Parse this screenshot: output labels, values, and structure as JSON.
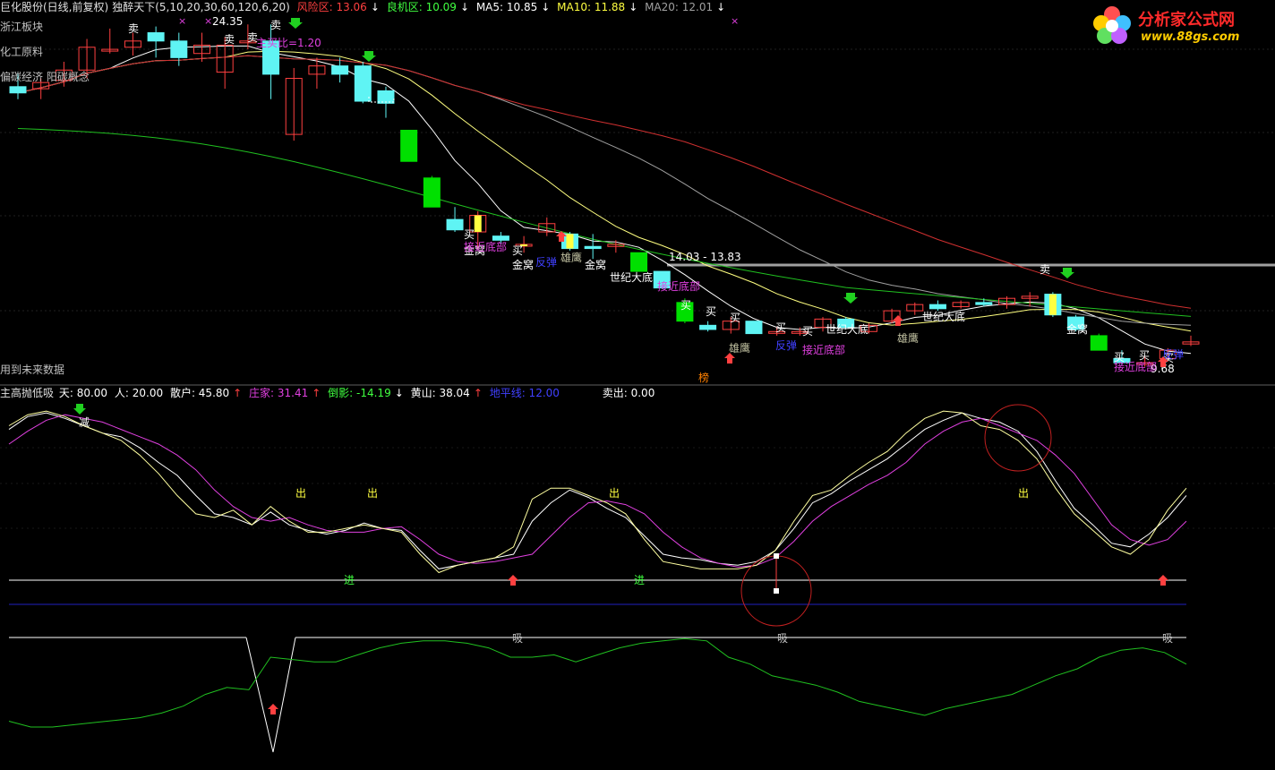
{
  "colors": {
    "bg": "#000000",
    "up": "#ff4040",
    "down_cyan": "#5ff4f4",
    "down_green": "#00e000",
    "yellow": "#ffff40",
    "magenta": "#e040e0",
    "white": "#ffffff",
    "green_line": "#20c020",
    "blue_line": "#2020c0",
    "orange": "#ff8000",
    "red_circle": "#c02020",
    "grey_line": "#a0a0a0"
  },
  "header": {
    "title": "巨化股份(日线,前复权)",
    "indicator": "独醉天下(5,10,20,30,60,120,6,20)",
    "risk_label": "风险区: 13.06",
    "good_label": "良机区: 10.09",
    "ma5": "MA5: 10.85",
    "ma10": "MA10: 11.88",
    "ma20": "MA20: 12.01"
  },
  "sidebar": {
    "sector1": "浙江板块",
    "sector2": "化工原料",
    "sector3": "偏碳经济 阳碳概念",
    "future_data": "用到未来数据"
  },
  "lower_header": {
    "name": "主高抛低吸",
    "tian": "天: 80.00",
    "ren": "人: 20.00",
    "sanhu": "散户: 45.80",
    "zhuangjia": "庄家: 31.41",
    "daoying": "倒影: -14.19",
    "huangshan": "黄山: 38.04",
    "dipingxian": "地平线: 12.00",
    "maichu": "卖出: 0.00"
  },
  "logo": {
    "name": "分析家公式网",
    "url": "www.88gs.com"
  },
  "chart_data": [
    {
      "type": "candlestick",
      "title": "巨化股份(日线,前复权)",
      "price_labels": [
        "24.35",
        "14.03 - 13.83",
        "9.68"
      ],
      "annotations_buy": [
        "买",
        "买",
        "买",
        "买",
        "买",
        "买",
        "买",
        "买",
        "买",
        "买"
      ],
      "annotations_sell": [
        "卖",
        "卖",
        "卖",
        "卖",
        "卖"
      ],
      "annotations_text": [
        {
          "text": "金窝",
          "kind": "jinwo"
        },
        {
          "text": "接近底部",
          "kind": "near"
        },
        {
          "text": "金窝",
          "kind": "jinwo"
        },
        {
          "text": "雄鹰",
          "kind": "xiongying"
        },
        {
          "text": "金窝",
          "kind": "jinwo"
        },
        {
          "text": "世纪大底",
          "kind": "shiji"
        },
        {
          "text": "接近底部",
          "kind": "near"
        },
        {
          "text": "雄鹰",
          "kind": "xiongying"
        },
        {
          "text": "反弹",
          "kind": "fantan"
        },
        {
          "text": "接近底部",
          "kind": "near"
        },
        {
          "text": "世纪大底",
          "kind": "shiji"
        },
        {
          "text": "雄鹰",
          "kind": "xiongying"
        },
        {
          "text": "世纪大底",
          "kind": "shiji"
        },
        {
          "text": "金窝",
          "kind": "jinwo"
        },
        {
          "text": "接近底部",
          "kind": "near"
        },
        {
          "text": "反弹",
          "kind": "fantan"
        },
        {
          "text": "反弹",
          "kind": "fantan"
        },
        {
          "text": "主买比=1.20",
          "kind": "ratio"
        },
        {
          "text": "榜",
          "kind": "bang"
        }
      ],
      "candles": [
        {
          "o": 17.6,
          "h": 18.3,
          "l": 17.0,
          "c": 17.3
        },
        {
          "o": 17.5,
          "h": 18.0,
          "l": 17.0,
          "c": 17.8
        },
        {
          "o": 17.9,
          "h": 18.8,
          "l": 17.6,
          "c": 18.4
        },
        {
          "o": 18.4,
          "h": 19.9,
          "l": 18.0,
          "c": 19.5
        },
        {
          "o": 19.4,
          "h": 20.4,
          "l": 19.2,
          "c": 19.4
        },
        {
          "o": 19.5,
          "h": 20.2,
          "l": 19.1,
          "c": 19.8
        },
        {
          "o": 20.2,
          "h": 20.5,
          "l": 19.0,
          "c": 19.8
        },
        {
          "o": 19.8,
          "h": 20.2,
          "l": 18.6,
          "c": 19.0
        },
        {
          "o": 19.2,
          "h": 20.2,
          "l": 18.8,
          "c": 19.6
        },
        {
          "o": 18.3,
          "h": 20.0,
          "l": 17.5,
          "c": 19.6
        },
        {
          "o": 19.8,
          "h": 20.6,
          "l": 19.4,
          "c": 19.8
        },
        {
          "o": 19.8,
          "h": 20.6,
          "l": 17.0,
          "c": 18.2
        },
        {
          "o": 15.3,
          "h": 18.5,
          "l": 15.0,
          "c": 18.0
        },
        {
          "o": 18.2,
          "h": 19.0,
          "l": 17.5,
          "c": 18.6
        },
        {
          "o": 18.6,
          "h": 19.0,
          "l": 17.8,
          "c": 18.2
        },
        {
          "o": 18.6,
          "h": 18.8,
          "l": 16.8,
          "c": 16.9
        },
        {
          "o": 17.4,
          "h": 17.6,
          "l": 16.1,
          "c": 16.8
        },
        {
          "o": 15.5,
          "h": 15.5,
          "l": 14.0,
          "c": 14.0
        },
        {
          "o": 13.2,
          "h": 13.3,
          "l": 11.8,
          "c": 11.8
        },
        {
          "o": 11.2,
          "h": 11.8,
          "l": 10.6,
          "c": 10.7
        },
        {
          "o": 10.6,
          "h": 11.6,
          "l": 9.8,
          "c": 11.4
        },
        {
          "o": 10.4,
          "h": 10.6,
          "l": 10.0,
          "c": 10.2
        },
        {
          "o": 10.0,
          "h": 10.4,
          "l": 9.6,
          "c": 10.0
        },
        {
          "o": 10.6,
          "h": 11.3,
          "l": 10.4,
          "c": 11.0
        },
        {
          "o": 10.5,
          "h": 10.6,
          "l": 9.7,
          "c": 9.8
        },
        {
          "o": 9.9,
          "h": 10.5,
          "l": 9.3,
          "c": 9.8
        },
        {
          "o": 9.9,
          "h": 10.2,
          "l": 9.6,
          "c": 10.0
        },
        {
          "o": 9.6,
          "h": 9.6,
          "l": 8.7,
          "c": 8.7
        },
        {
          "o": 8.7,
          "h": 8.6,
          "l": 7.9,
          "c": 7.9
        },
        {
          "o": 7.2,
          "h": 7.4,
          "l": 6.2,
          "c": 6.3
        },
        {
          "o": 6.1,
          "h": 6.3,
          "l": 5.8,
          "c": 5.9
        },
        {
          "o": 5.9,
          "h": 6.5,
          "l": 5.7,
          "c": 6.3
        },
        {
          "o": 6.3,
          "h": 6.3,
          "l": 5.7,
          "c": 5.7
        },
        {
          "o": 5.8,
          "h": 6.0,
          "l": 5.6,
          "c": 5.8
        },
        {
          "o": 5.8,
          "h": 6.0,
          "l": 5.6,
          "c": 5.8
        },
        {
          "o": 6.0,
          "h": 6.5,
          "l": 5.8,
          "c": 6.4
        },
        {
          "o": 6.4,
          "h": 6.5,
          "l": 6.0,
          "c": 6.0
        },
        {
          "o": 5.8,
          "h": 6.2,
          "l": 5.7,
          "c": 6.1
        },
        {
          "o": 6.3,
          "h": 6.9,
          "l": 6.2,
          "c": 6.8
        },
        {
          "o": 6.8,
          "h": 7.2,
          "l": 6.6,
          "c": 7.1
        },
        {
          "o": 7.1,
          "h": 7.3,
          "l": 6.8,
          "c": 6.9
        },
        {
          "o": 7.0,
          "h": 7.3,
          "l": 6.9,
          "c": 7.2
        },
        {
          "o": 7.2,
          "h": 7.4,
          "l": 7.0,
          "c": 7.1
        },
        {
          "o": 7.1,
          "h": 7.5,
          "l": 6.9,
          "c": 7.4
        },
        {
          "o": 7.4,
          "h": 7.7,
          "l": 7.0,
          "c": 7.5
        },
        {
          "o": 7.6,
          "h": 7.7,
          "l": 6.5,
          "c": 6.6
        },
        {
          "o": 6.5,
          "h": 6.6,
          "l": 5.8,
          "c": 5.9
        },
        {
          "o": 5.6,
          "h": 5.7,
          "l": 4.9,
          "c": 4.9
        },
        {
          "o": 4.5,
          "h": 4.9,
          "l": 4.2,
          "c": 4.3
        },
        {
          "o": 4.3,
          "h": 4.6,
          "l": 4.1,
          "c": 4.3
        },
        {
          "o": 4.5,
          "h": 5.0,
          "l": 4.4,
          "c": 4.9
        },
        {
          "o": 5.2,
          "h": 5.6,
          "l": 5.1,
          "c": 5.3
        }
      ]
    },
    {
      "type": "line",
      "title": "主高抛低吸",
      "reference_lines": [
        80,
        20,
        12
      ],
      "labels": [
        "减",
        "出",
        "出",
        "出",
        "出",
        "进",
        "进",
        "吸",
        "吸",
        "吸"
      ],
      "series": [
        {
          "name": "散户",
          "values": [
            88,
            95,
            97,
            94,
            90,
            86,
            84,
            78,
            70,
            63,
            52,
            42,
            40,
            36,
            43,
            36,
            33,
            31,
            33,
            37,
            34,
            33,
            22,
            12,
            14,
            16,
            18,
            20,
            38,
            48,
            55,
            51,
            45,
            40,
            30,
            20,
            18,
            17,
            15,
            14,
            16,
            22,
            34,
            48,
            53,
            60,
            66,
            72,
            80,
            88,
            93,
            97,
            94,
            92,
            87,
            76,
            60,
            45,
            36,
            26,
            24,
            31,
            40,
            52
          ]
        },
        {
          "name": "庄家",
          "values": [
            80,
            87,
            93,
            96,
            94,
            92,
            88,
            84,
            80,
            74,
            66,
            55,
            46,
            40,
            38,
            40,
            36,
            33,
            32,
            32,
            34,
            35,
            28,
            20,
            16,
            15,
            16,
            18,
            20,
            30,
            40,
            48,
            49,
            47,
            42,
            32,
            24,
            18,
            15,
            13,
            14,
            18,
            27,
            38,
            46,
            52,
            58,
            63,
            70,
            80,
            87,
            92,
            94,
            90,
            86,
            82,
            74,
            64,
            50,
            36,
            28,
            25,
            28,
            38
          ]
        },
        {
          "name": "天",
          "values": [
            90,
            96,
            98,
            95,
            90,
            86,
            82,
            74,
            64,
            52,
            42,
            40,
            44,
            36,
            46,
            38,
            32,
            32,
            34,
            36,
            34,
            32,
            20,
            10,
            14,
            16,
            18,
            24,
            50,
            56,
            56,
            52,
            48,
            42,
            28,
            16,
            14,
            12,
            12,
            12,
            14,
            22,
            38,
            52,
            55,
            63,
            70,
            76,
            86,
            94,
            98,
            97,
            90,
            88,
            82,
            72,
            56,
            42,
            33,
            24,
            20,
            28,
            44,
            56
          ]
        },
        {
          "name": "黄山",
          "values": [
            -75,
            -80,
            -80,
            -78,
            -76,
            -74,
            -72,
            -68,
            -62,
            -52,
            -46,
            -48,
            -20,
            -22,
            -24,
            -24,
            -18,
            -12,
            -8,
            -6,
            -6,
            -8,
            -12,
            -20,
            -20,
            -18,
            -24,
            -18,
            -12,
            -8,
            -6,
            -4,
            -6,
            -20,
            -26,
            -36,
            -40,
            -44,
            -50,
            -58,
            -62,
            -66,
            -70,
            -64,
            -60,
            -56,
            -52,
            -44,
            -36,
            -30,
            -20,
            -14,
            -12,
            -16,
            -26
          ]
        }
      ]
    }
  ]
}
